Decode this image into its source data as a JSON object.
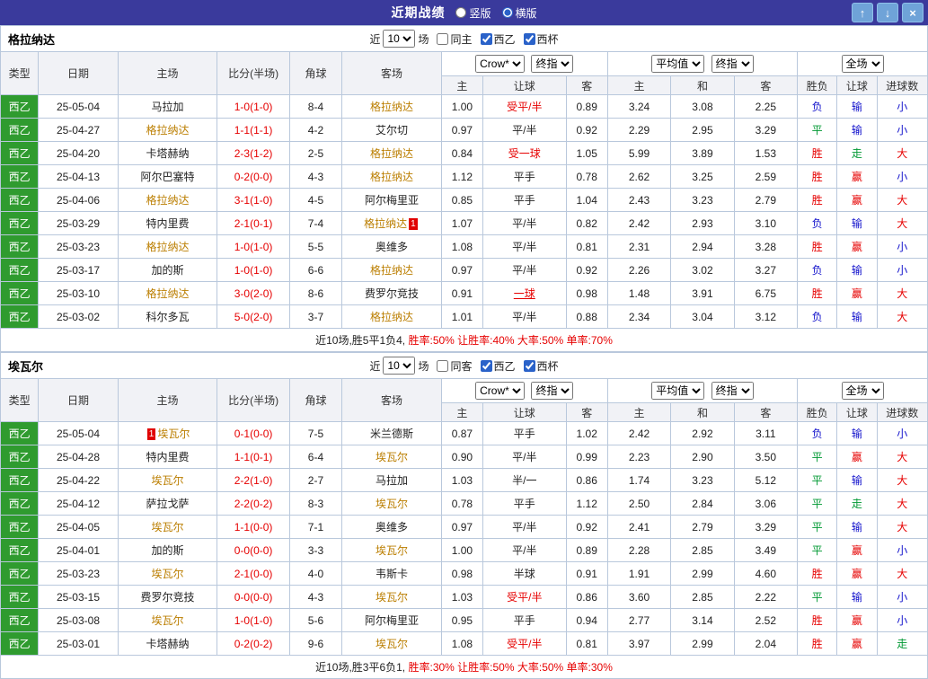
{
  "topbar": {
    "title": "近期战绩",
    "radio_vertical": "竖版",
    "radio_horizontal": "横版",
    "vertical_checked": false,
    "horizontal_checked": true,
    "up_icon": "↑",
    "down_icon": "↓",
    "close_icon": "×"
  },
  "labels": {
    "recent": "近",
    "matches": "场"
  },
  "selects": {
    "bookmaker": "Crow*",
    "odds_time": "终指",
    "euro_avg": "平均值",
    "euro_time": "终指",
    "scope": "全场"
  },
  "table_header": {
    "type": "类型",
    "date": "日期",
    "home": "主场",
    "score": "比分(半场)",
    "corner": "角球",
    "away": "客场",
    "h": "主",
    "handicap": "让球",
    "a": "客",
    "eh": "主",
    "ed": "和",
    "ea": "客",
    "result": "胜负",
    "handicap_result": "让球",
    "goals": "进球数"
  },
  "colors": {
    "topbar_bg": "#3a3a9c",
    "type_cell_bg": "#2f9b2f",
    "focus_team": "#bb7e00",
    "win": "#e60000",
    "draw": "#009933",
    "loss": "#1414cc"
  },
  "sections": [
    {
      "team": "格拉纳达",
      "filter": {
        "count": "10",
        "same_label": "同主",
        "same_checked": false,
        "league_label": "西乙",
        "league_checked": true,
        "cup_label": "西杯",
        "cup_checked": true
      },
      "summary_prefix": "近10场,胜5平1负4,",
      "summary_rates": "胜率:50% 让胜率:40% 大率:50% 单率:70%",
      "rows": [
        {
          "type": "西乙",
          "date": "25-05-04",
          "home": "马拉加",
          "home_focus": false,
          "score": "1-0(1-0)",
          "corner": "8-4",
          "away": "格拉纳达",
          "away_focus": true,
          "h": "1.00",
          "handicap": "受平/半",
          "handicap_red": true,
          "a": "0.89",
          "eh": "3.24",
          "ed": "3.08",
          "ea": "2.25",
          "result": "负",
          "result_c": "blue",
          "hres": "输",
          "hres_c": "blue",
          "goals": "小",
          "goals_c": "blue"
        },
        {
          "type": "西乙",
          "date": "25-04-27",
          "home": "格拉纳达",
          "home_focus": true,
          "score": "1-1(1-1)",
          "corner": "4-2",
          "away": "艾尔切",
          "away_focus": false,
          "h": "0.97",
          "handicap": "平/半",
          "handicap_red": false,
          "a": "0.92",
          "eh": "2.29",
          "ed": "2.95",
          "ea": "3.29",
          "result": "平",
          "result_c": "green",
          "hres": "输",
          "hres_c": "blue",
          "goals": "小",
          "goals_c": "blue"
        },
        {
          "type": "西乙",
          "date": "25-04-20",
          "home": "卡塔赫纳",
          "home_focus": false,
          "score": "2-3(1-2)",
          "corner": "2-5",
          "away": "格拉纳达",
          "away_focus": true,
          "h": "0.84",
          "handicap": "受一球",
          "handicap_red": true,
          "a": "1.05",
          "eh": "5.99",
          "ed": "3.89",
          "ea": "1.53",
          "result": "胜",
          "result_c": "red",
          "hres": "走",
          "hres_c": "green",
          "goals": "大",
          "goals_c": "red"
        },
        {
          "type": "西乙",
          "date": "25-04-13",
          "home": "阿尔巴塞特",
          "home_focus": false,
          "score": "0-2(0-0)",
          "corner": "4-3",
          "away": "格拉纳达",
          "away_focus": true,
          "h": "1.12",
          "handicap": "平手",
          "handicap_red": false,
          "a": "0.78",
          "eh": "2.62",
          "ed": "3.25",
          "ea": "2.59",
          "result": "胜",
          "result_c": "red",
          "hres": "赢",
          "hres_c": "red",
          "goals": "小",
          "goals_c": "blue"
        },
        {
          "type": "西乙",
          "date": "25-04-06",
          "home": "格拉纳达",
          "home_focus": true,
          "score": "3-1(1-0)",
          "corner": "4-5",
          "away": "阿尔梅里亚",
          "away_focus": false,
          "h": "0.85",
          "handicap": "平手",
          "handicap_red": false,
          "a": "1.04",
          "eh": "2.43",
          "ed": "3.23",
          "ea": "2.79",
          "result": "胜",
          "result_c": "red",
          "hres": "赢",
          "hres_c": "red",
          "goals": "大",
          "goals_c": "red"
        },
        {
          "type": "西乙",
          "date": "25-03-29",
          "home": "特内里费",
          "home_focus": false,
          "score": "2-1(0-1)",
          "corner": "7-4",
          "away": "格拉纳达",
          "away_focus": true,
          "away_badge": {
            "text": "1",
            "pos": "after"
          },
          "h": "1.07",
          "handicap": "平/半",
          "handicap_red": false,
          "a": "0.82",
          "eh": "2.42",
          "ed": "2.93",
          "ea": "3.10",
          "result": "负",
          "result_c": "blue",
          "hres": "输",
          "hres_c": "blue",
          "goals": "大",
          "goals_c": "red"
        },
        {
          "type": "西乙",
          "date": "25-03-23",
          "home": "格拉纳达",
          "home_focus": true,
          "score": "1-0(1-0)",
          "corner": "5-5",
          "away": "奥维多",
          "away_focus": false,
          "h": "1.08",
          "handicap": "平/半",
          "handicap_red": false,
          "a": "0.81",
          "eh": "2.31",
          "ed": "2.94",
          "ea": "3.28",
          "result": "胜",
          "result_c": "red",
          "hres": "赢",
          "hres_c": "red",
          "goals": "小",
          "goals_c": "blue"
        },
        {
          "type": "西乙",
          "date": "25-03-17",
          "home": "加的斯",
          "home_focus": false,
          "score": "1-0(1-0)",
          "corner": "6-6",
          "away": "格拉纳达",
          "away_focus": true,
          "h": "0.97",
          "handicap": "平/半",
          "handicap_red": false,
          "a": "0.92",
          "eh": "2.26",
          "ed": "3.02",
          "ea": "3.27",
          "result": "负",
          "result_c": "blue",
          "hres": "输",
          "hres_c": "blue",
          "goals": "小",
          "goals_c": "blue"
        },
        {
          "type": "西乙",
          "date": "25-03-10",
          "home": "格拉纳达",
          "home_focus": true,
          "score": "3-0(2-0)",
          "corner": "8-6",
          "away": "费罗尔竞技",
          "away_focus": false,
          "h": "0.91",
          "handicap": "一球",
          "handicap_red": true,
          "handicap_u": true,
          "a": "0.98",
          "eh": "1.48",
          "ed": "3.91",
          "ea": "6.75",
          "result": "胜",
          "result_c": "red",
          "hres": "赢",
          "hres_c": "red",
          "goals": "大",
          "goals_c": "red"
        },
        {
          "type": "西乙",
          "date": "25-03-02",
          "home": "科尔多瓦",
          "home_focus": false,
          "score": "5-0(2-0)",
          "corner": "3-7",
          "away": "格拉纳达",
          "away_focus": true,
          "h": "1.01",
          "handicap": "平/半",
          "handicap_red": false,
          "a": "0.88",
          "eh": "2.34",
          "ed": "3.04",
          "ea": "3.12",
          "result": "负",
          "result_c": "blue",
          "hres": "输",
          "hres_c": "blue",
          "goals": "大",
          "goals_c": "red"
        }
      ]
    },
    {
      "team": "埃瓦尔",
      "filter": {
        "count": "10",
        "same_label": "同客",
        "same_checked": false,
        "league_label": "西乙",
        "league_checked": true,
        "cup_label": "西杯",
        "cup_checked": true
      },
      "summary_prefix": "近10场,胜3平6负1,",
      "summary_rates": "胜率:30% 让胜率:50% 大率:50% 单率:30%",
      "rows": [
        {
          "type": "西乙",
          "date": "25-05-04",
          "home": "埃瓦尔",
          "home_focus": true,
          "home_badge": {
            "text": "1",
            "pos": "before"
          },
          "score": "0-1(0-0)",
          "corner": "7-5",
          "away": "米兰德斯",
          "away_focus": false,
          "h": "0.87",
          "handicap": "平手",
          "handicap_red": false,
          "a": "1.02",
          "eh": "2.42",
          "ed": "2.92",
          "ea": "3.11",
          "result": "负",
          "result_c": "blue",
          "hres": "输",
          "hres_c": "blue",
          "goals": "小",
          "goals_c": "blue"
        },
        {
          "type": "西乙",
          "date": "25-04-28",
          "home": "特内里费",
          "home_focus": false,
          "score": "1-1(0-1)",
          "corner": "6-4",
          "away": "埃瓦尔",
          "away_focus": true,
          "h": "0.90",
          "handicap": "平/半",
          "handicap_red": false,
          "a": "0.99",
          "eh": "2.23",
          "ed": "2.90",
          "ea": "3.50",
          "result": "平",
          "result_c": "green",
          "hres": "赢",
          "hres_c": "red",
          "goals": "大",
          "goals_c": "red"
        },
        {
          "type": "西乙",
          "date": "25-04-22",
          "home": "埃瓦尔",
          "home_focus": true,
          "score": "2-2(1-0)",
          "corner": "2-7",
          "away": "马拉加",
          "away_focus": false,
          "h": "1.03",
          "handicap": "半/一",
          "handicap_red": false,
          "a": "0.86",
          "eh": "1.74",
          "ed": "3.23",
          "ea": "5.12",
          "result": "平",
          "result_c": "green",
          "hres": "输",
          "hres_c": "blue",
          "goals": "大",
          "goals_c": "red"
        },
        {
          "type": "西乙",
          "date": "25-04-12",
          "home": "萨拉戈萨",
          "home_focus": false,
          "score": "2-2(0-2)",
          "corner": "8-3",
          "away": "埃瓦尔",
          "away_focus": true,
          "h": "0.78",
          "handicap": "平手",
          "handicap_red": false,
          "a": "1.12",
          "eh": "2.50",
          "ed": "2.84",
          "ea": "3.06",
          "result": "平",
          "result_c": "green",
          "hres": "走",
          "hres_c": "green",
          "goals": "大",
          "goals_c": "red"
        },
        {
          "type": "西乙",
          "date": "25-04-05",
          "home": "埃瓦尔",
          "home_focus": true,
          "score": "1-1(0-0)",
          "corner": "7-1",
          "away": "奥维多",
          "away_focus": false,
          "h": "0.97",
          "handicap": "平/半",
          "handicap_red": false,
          "a": "0.92",
          "eh": "2.41",
          "ed": "2.79",
          "ea": "3.29",
          "result": "平",
          "result_c": "green",
          "hres": "输",
          "hres_c": "blue",
          "goals": "大",
          "goals_c": "red"
        },
        {
          "type": "西乙",
          "date": "25-04-01",
          "home": "加的斯",
          "home_focus": false,
          "score": "0-0(0-0)",
          "corner": "3-3",
          "away": "埃瓦尔",
          "away_focus": true,
          "h": "1.00",
          "handicap": "平/半",
          "handicap_red": false,
          "a": "0.89",
          "eh": "2.28",
          "ed": "2.85",
          "ea": "3.49",
          "result": "平",
          "result_c": "green",
          "hres": "赢",
          "hres_c": "red",
          "goals": "小",
          "goals_c": "blue"
        },
        {
          "type": "西乙",
          "date": "25-03-23",
          "home": "埃瓦尔",
          "home_focus": true,
          "score": "2-1(0-0)",
          "corner": "4-0",
          "away": "韦斯卡",
          "away_focus": false,
          "h": "0.98",
          "handicap": "半球",
          "handicap_red": false,
          "a": "0.91",
          "eh": "1.91",
          "ed": "2.99",
          "ea": "4.60",
          "result": "胜",
          "result_c": "red",
          "hres": "赢",
          "hres_c": "red",
          "goals": "大",
          "goals_c": "red"
        },
        {
          "type": "西乙",
          "date": "25-03-15",
          "home": "费罗尔竞技",
          "home_focus": false,
          "score": "0-0(0-0)",
          "corner": "4-3",
          "away": "埃瓦尔",
          "away_focus": true,
          "h": "1.03",
          "handicap": "受平/半",
          "handicap_red": true,
          "a": "0.86",
          "eh": "3.60",
          "ed": "2.85",
          "ea": "2.22",
          "result": "平",
          "result_c": "green",
          "hres": "输",
          "hres_c": "blue",
          "goals": "小",
          "goals_c": "blue"
        },
        {
          "type": "西乙",
          "date": "25-03-08",
          "home": "埃瓦尔",
          "home_focus": true,
          "score": "1-0(1-0)",
          "corner": "5-6",
          "away": "阿尔梅里亚",
          "away_focus": false,
          "h": "0.95",
          "handicap": "平手",
          "handicap_red": false,
          "a": "0.94",
          "eh": "2.77",
          "ed": "3.14",
          "ea": "2.52",
          "result": "胜",
          "result_c": "red",
          "hres": "赢",
          "hres_c": "red",
          "goals": "小",
          "goals_c": "blue"
        },
        {
          "type": "西乙",
          "date": "25-03-01",
          "home": "卡塔赫纳",
          "home_focus": false,
          "score": "0-2(0-2)",
          "corner": "9-6",
          "away": "埃瓦尔",
          "away_focus": true,
          "h": "1.08",
          "handicap": "受平/半",
          "handicap_red": true,
          "a": "0.81",
          "eh": "3.97",
          "ed": "2.99",
          "ea": "2.04",
          "result": "胜",
          "result_c": "red",
          "hres": "赢",
          "hres_c": "red",
          "goals": "走",
          "goals_c": "green"
        }
      ]
    }
  ]
}
